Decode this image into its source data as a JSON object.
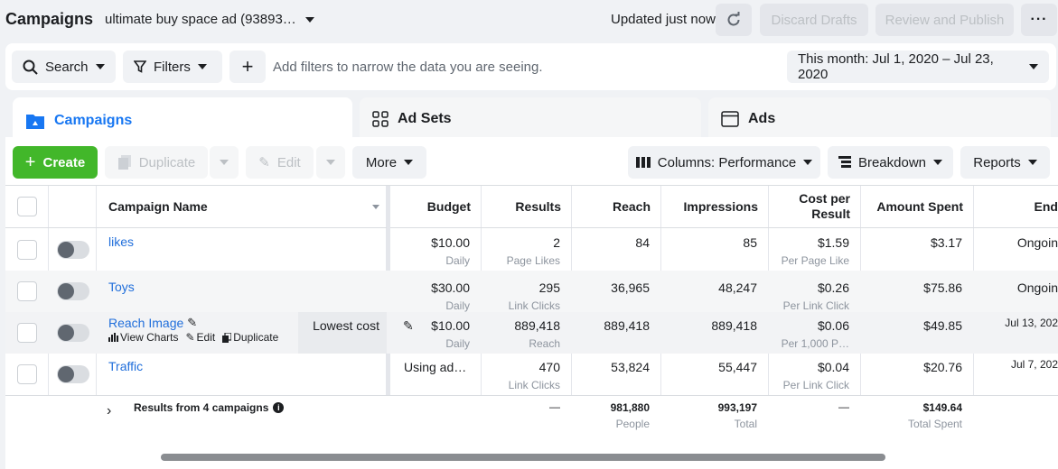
{
  "header": {
    "title": "Campaigns",
    "account": "ultimate buy space ad (93893…",
    "updated": "Updated just now",
    "discard_label": "Discard Drafts",
    "review_label": "Review and Publish",
    "more_label": "···"
  },
  "filterbar": {
    "search_label": "Search",
    "filters_label": "Filters",
    "add_label": "+",
    "hint": "Add filters to narrow the data you are seeing.",
    "date_range": "This month: Jul 1, 2020 – Jul 23, 2020"
  },
  "tabs": [
    {
      "label": "Campaigns",
      "active": true
    },
    {
      "label": "Ad Sets",
      "active": false
    },
    {
      "label": "Ads",
      "active": false
    }
  ],
  "toolbar": {
    "create_label": "Create",
    "duplicate_label": "Duplicate",
    "edit_label": "Edit",
    "more_label": "More",
    "columns_label": "Columns: Performance",
    "breakdown_label": "Breakdown",
    "reports_label": "Reports"
  },
  "columns": {
    "name": "Campaign Name",
    "budget": "Budget",
    "results": "Results",
    "reach": "Reach",
    "impressions": "Impressions",
    "cpr_line1": "Cost per",
    "cpr_line2": "Result",
    "spent": "Amount Spent",
    "ends": "End"
  },
  "rows": [
    {
      "name": "likes",
      "bid": "",
      "budget": "$10.00",
      "budget_sub": "Daily",
      "results": "2",
      "results_sub": "Page Likes",
      "reach": "84",
      "impressions": "85",
      "cpr": "$1.59",
      "cpr_sub": "Per Page Like",
      "spent": "$3.17",
      "ends": "Ongoin"
    },
    {
      "name": "Toys",
      "bid": "",
      "budget": "$30.00",
      "budget_sub": "Daily",
      "results": "295",
      "results_sub": "Link Clicks",
      "reach": "36,965",
      "impressions": "48,247",
      "cpr": "$0.26",
      "cpr_sub": "Per Link Click",
      "spent": "$75.86",
      "ends": "Ongoin"
    },
    {
      "name": "Reach Image",
      "bid": "Lowest cost",
      "budget": "$10.00",
      "budget_sub": "Daily",
      "results": "889,418",
      "results_sub": "Reach",
      "reach": "889,418",
      "impressions": "889,418",
      "cpr": "$0.06",
      "cpr_sub": "Per 1,000 P…",
      "spent": "$49.85",
      "ends": "Jul 13, 202"
    },
    {
      "name": "Traffic",
      "bid": "",
      "budget": "Using ad…",
      "budget_sub": "",
      "results": "470",
      "results_sub": "Link Clicks",
      "reach": "53,824",
      "impressions": "55,447",
      "cpr": "$0.04",
      "cpr_sub": "Per Link Click",
      "spent": "$20.76",
      "ends": "Jul 7, 202"
    }
  ],
  "row_actions": {
    "view_charts": "View Charts",
    "edit": "Edit",
    "duplicate": "Duplicate"
  },
  "summary": {
    "label": "Results from 4 campaigns",
    "results": "—",
    "reach": "981,880",
    "reach_sub": "People",
    "impressions": "993,197",
    "impressions_sub": "Total",
    "cpr": "—",
    "spent": "$149.64",
    "spent_sub": "Total Spent"
  },
  "colors": {
    "brand": "#1877f2",
    "create": "#42b72a",
    "link": "#216fdb"
  }
}
